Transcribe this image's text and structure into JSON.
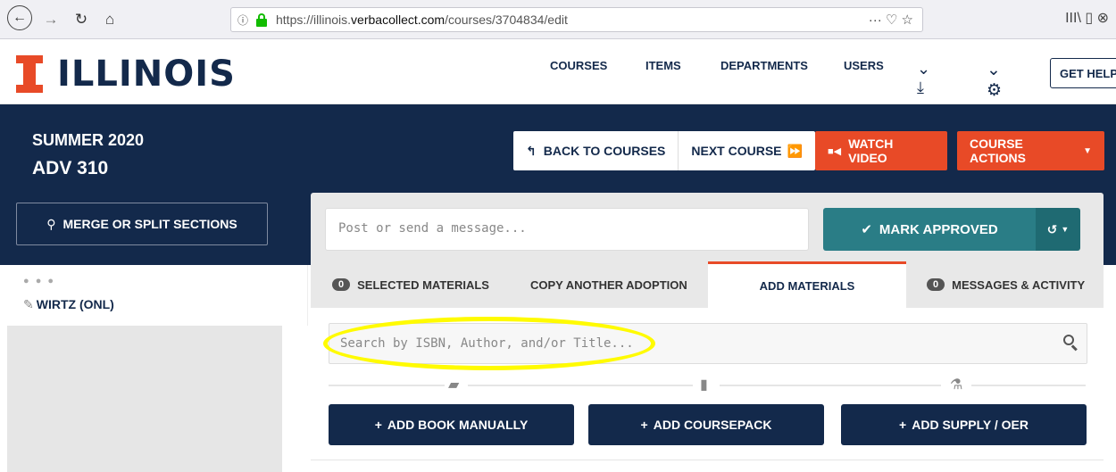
{
  "browser": {
    "url_domain": "https://illinois.",
    "url_host": "verbacollect.com",
    "url_path": "/courses/3704834/edit",
    "actions": "··· ♡ ☆",
    "right_icons": "III\\  ▯  ⊗"
  },
  "header": {
    "logo_text": "ILLINOIS",
    "nav": {
      "courses": "COURSES",
      "items": "ITEMS",
      "departments": "DEPARTMENTS",
      "users": "USERS"
    },
    "help": "GET HELP"
  },
  "course": {
    "term": "SUMMER 2020",
    "code": "ADV 310",
    "back_label": "BACK TO COURSES",
    "next_label": "NEXT COURSE",
    "watch_label": "WATCH VIDEO",
    "actions_label": "COURSE ACTIONS",
    "merge_label": "MERGE OR SPLIT SECTIONS"
  },
  "section": {
    "dots": "● ● ●",
    "name": "WIRTZ (ONL)"
  },
  "message": {
    "placeholder": "Post or send a message...",
    "approve_label": "MARK APPROVED"
  },
  "tabs": {
    "selected_count": "0",
    "selected_label": "SELECTED MATERIALS",
    "copy_label": "COPY ANOTHER ADOPTION",
    "add_label": "ADD MATERIALS",
    "messages_count": "0",
    "messages_label": "MESSAGES & ACTIVITY"
  },
  "materials": {
    "search_placeholder": "Search by ISBN, Author, and/or Title...",
    "add_book": "ADD BOOK MANUALLY",
    "add_coursepack": "ADD COURSEPACK",
    "add_supply": "ADD SUPPLY / OER"
  },
  "colors": {
    "navy": "#13294b",
    "orange": "#e84a27",
    "teal": "#2a7d86",
    "highlight": "#fffb00"
  }
}
